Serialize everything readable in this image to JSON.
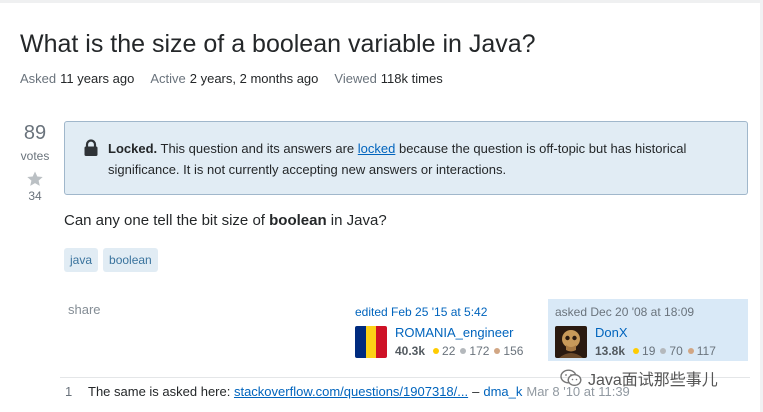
{
  "question": {
    "title": "What is the size of a boolean variable in Java?",
    "meta": {
      "asked_label": "Asked",
      "asked_value": "11 years ago",
      "active_label": "Active",
      "active_value": "2 years, 2 months ago",
      "viewed_label": "Viewed",
      "viewed_value": "118k times"
    },
    "votes": {
      "count": "89",
      "label": "votes",
      "favorite_count": "34"
    },
    "locked_notice": {
      "title": "Locked.",
      "text_before": " This question and its answers are ",
      "link": "locked",
      "text_after": " because the question is off-topic but has historical significance. It is not currently accepting new answers or interactions."
    },
    "body": {
      "before": "Can any one tell the bit size of ",
      "bold": "boolean",
      "after": " in Java?"
    },
    "tags": [
      "java",
      "boolean"
    ],
    "share_label": "share",
    "edited": {
      "time": "edited Feb 25 '15 at 5:42",
      "user": "ROMANIA_engineer",
      "rep": "40.3k",
      "gold": "22",
      "silver": "172",
      "bronze": "156"
    },
    "asked": {
      "time": "asked Dec 20 '08 at 18:09",
      "user": "DonX",
      "rep": "13.8k",
      "gold": "19",
      "silver": "70",
      "bronze": "117"
    }
  },
  "comment": {
    "score": "1",
    "text": "The same is asked here: ",
    "link": "stackoverflow.com/questions/1907318/...",
    "dash": "–",
    "user": "dma_k",
    "date": "Mar 8 '10 at 11:39"
  },
  "watermark": {
    "text": "Java面试那些事儿"
  },
  "colors": {
    "link": "#0064bd",
    "notice_bg": "#e1ecf4",
    "owner_bg": "#d9e9f7",
    "tag_bg": "#e1ecf4",
    "tag_text": "#39739d"
  },
  "icons": {
    "lock": "lock-icon",
    "favorite": "star-icon"
  }
}
